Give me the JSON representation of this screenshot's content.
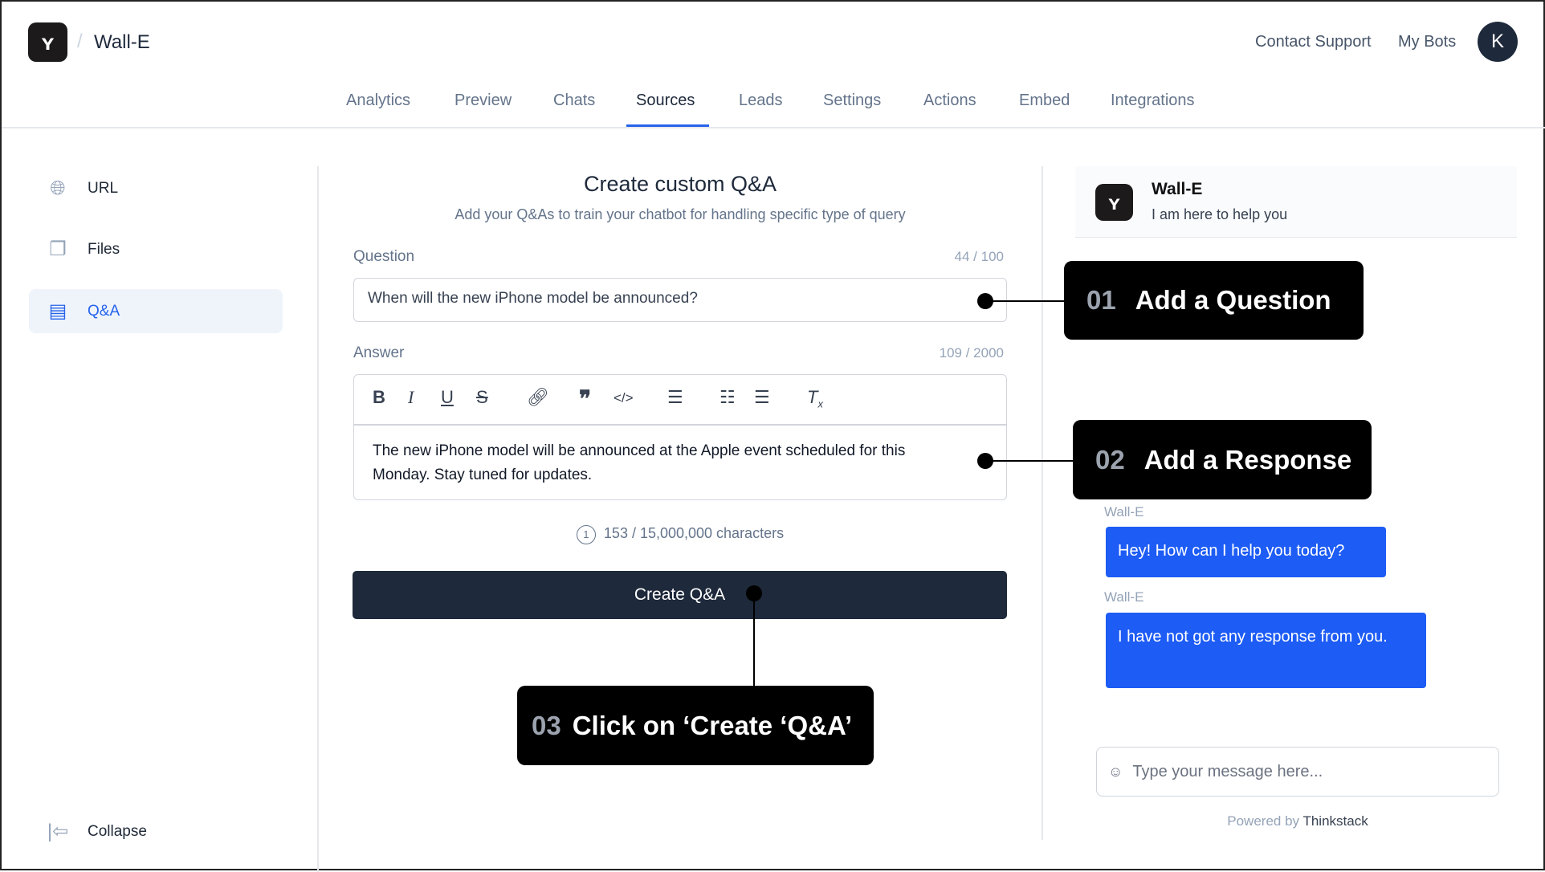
{
  "header": {
    "logo_glyph": "ʏ",
    "separator": "/",
    "bot_name": "Wall-E",
    "contact_support": "Contact Support",
    "my_bots": "My Bots",
    "avatar_initial": "K"
  },
  "tabs": [
    {
      "label": "Analytics"
    },
    {
      "label": "Preview"
    },
    {
      "label": "Chats"
    },
    {
      "label": "Sources",
      "active": true
    },
    {
      "label": "Leads"
    },
    {
      "label": "Settings"
    },
    {
      "label": "Actions"
    },
    {
      "label": "Embed"
    },
    {
      "label": "Integrations"
    }
  ],
  "sidebar": {
    "items": [
      {
        "label": "URL",
        "icon": "globe-icon"
      },
      {
        "label": "Files",
        "icon": "files-icon"
      },
      {
        "label": "Q&A",
        "icon": "chat-icon",
        "active": true
      }
    ],
    "collapse": "Collapse"
  },
  "form": {
    "title": "Create custom Q&A",
    "subtitle": "Add your Q&As to train your chatbot for handling specific type of query",
    "question_label": "Question",
    "question_counter": "44 / 100",
    "question_value": "When will the new iPhone model be announced?",
    "answer_label": "Answer",
    "answer_counter": "109 / 2000",
    "answer_value": "The new iPhone model will be announced at the Apple event scheduled for this Monday. Stay tuned for updates.",
    "char_count": "153 / 15,000,000 characters",
    "submit": "Create Q&A"
  },
  "chat": {
    "bot_name": "Wall-E",
    "bot_subtitle": "I am here to help you",
    "messages": [
      {
        "sender": "Wall-E",
        "text": "Hey! How can I help you today?"
      },
      {
        "sender": "Wall-E",
        "text": "I have not got any response from you."
      }
    ],
    "input_placeholder": "Type your message here...",
    "powered_by": "Powered by",
    "brand": "Thinkstack"
  },
  "callouts": [
    {
      "num": "01",
      "text": "Add a Question"
    },
    {
      "num": "02",
      "text": "Add a Response"
    },
    {
      "num": "03",
      "text": "Click on ‘Create ‘Q&A’"
    }
  ],
  "colors": {
    "accent": "#2563eb",
    "button": "#1e293b",
    "bubble": "#1d5cf5"
  }
}
